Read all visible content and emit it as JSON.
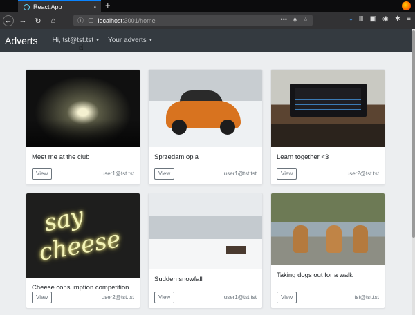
{
  "browser": {
    "tab_title": "React App",
    "new_tab": "+",
    "close_tab": "×",
    "url_host": "localhost",
    "url_path": ":3001/home",
    "url_more": "•••"
  },
  "app": {
    "brand": "Adverts",
    "user_menu": "Hi, tst@tst.tst",
    "adverts_menu": "Your adverts"
  },
  "adverts": [
    {
      "title": "Meet me at the club",
      "author": "user1@tst.tst",
      "view_label": "View"
    },
    {
      "title": "Sprzedam opla",
      "author": "user1@tst.tst",
      "view_label": "View"
    },
    {
      "title": "Learn together <3",
      "author": "user2@tst.tst",
      "view_label": "View"
    },
    {
      "title": "Cheese consumption competition",
      "author": "user2@tst.tst",
      "view_label": "View"
    },
    {
      "title": "Sudden snowfall",
      "author": "user1@tst.tst",
      "view_label": "View"
    },
    {
      "title": "Taking dogs out for a walk",
      "author": "tst@tst.tst",
      "view_label": "View"
    }
  ],
  "neon_text": [
    "say",
    "cheese"
  ],
  "colors": {
    "navbar": "#343a40",
    "page_bg": "#eceef0",
    "firefox_accent": "#0a84ff"
  }
}
